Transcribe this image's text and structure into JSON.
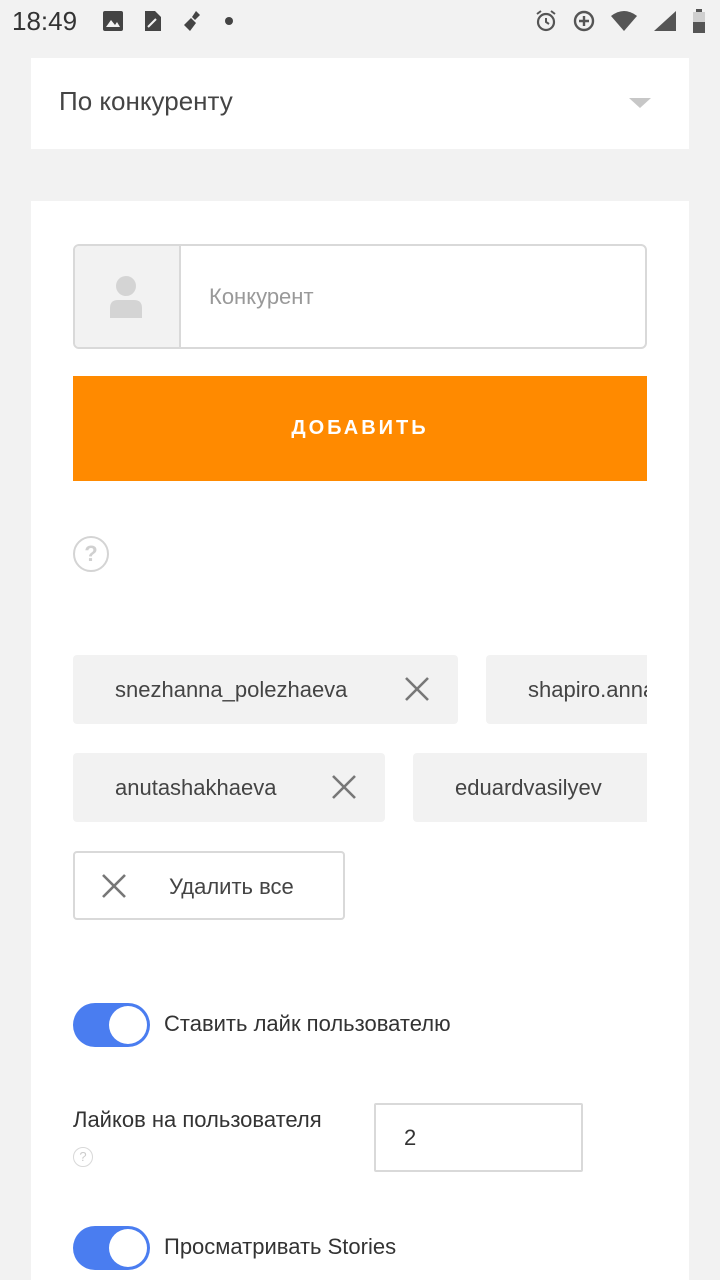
{
  "status_bar": {
    "time": "18:49",
    "left_icons": [
      "image-icon",
      "document-icon",
      "broom-icon",
      "dot-icon"
    ],
    "right_icons": [
      "alarm-icon",
      "data-saver-icon",
      "wifi-icon",
      "signal-icon",
      "battery-icon"
    ]
  },
  "filter": {
    "selected": "По конкуренту"
  },
  "competitor_form": {
    "input_placeholder": "Конкурент",
    "input_value": "",
    "add_label": "ДОБАВИТЬ"
  },
  "competitors": [
    {
      "name": "snezhanna_polezhaeva"
    },
    {
      "name": "shapiro.anna"
    },
    {
      "name": "anutashakhaeva"
    },
    {
      "name": "eduardvasilyev"
    }
  ],
  "delete_all_label": "Удалить все",
  "settings": {
    "like_user_label": "Ставить лайк пользователю",
    "like_user_enabled": true,
    "likes_per_user_label": "Лайков на пользователя",
    "likes_per_user_value": "2",
    "view_stories_label": "Просматривать Stories",
    "view_stories_enabled": true
  },
  "colors": {
    "accent": "#ff8a00",
    "toggle_on": "#4a7df0",
    "background": "#f2f2f2",
    "card": "#ffffff"
  }
}
